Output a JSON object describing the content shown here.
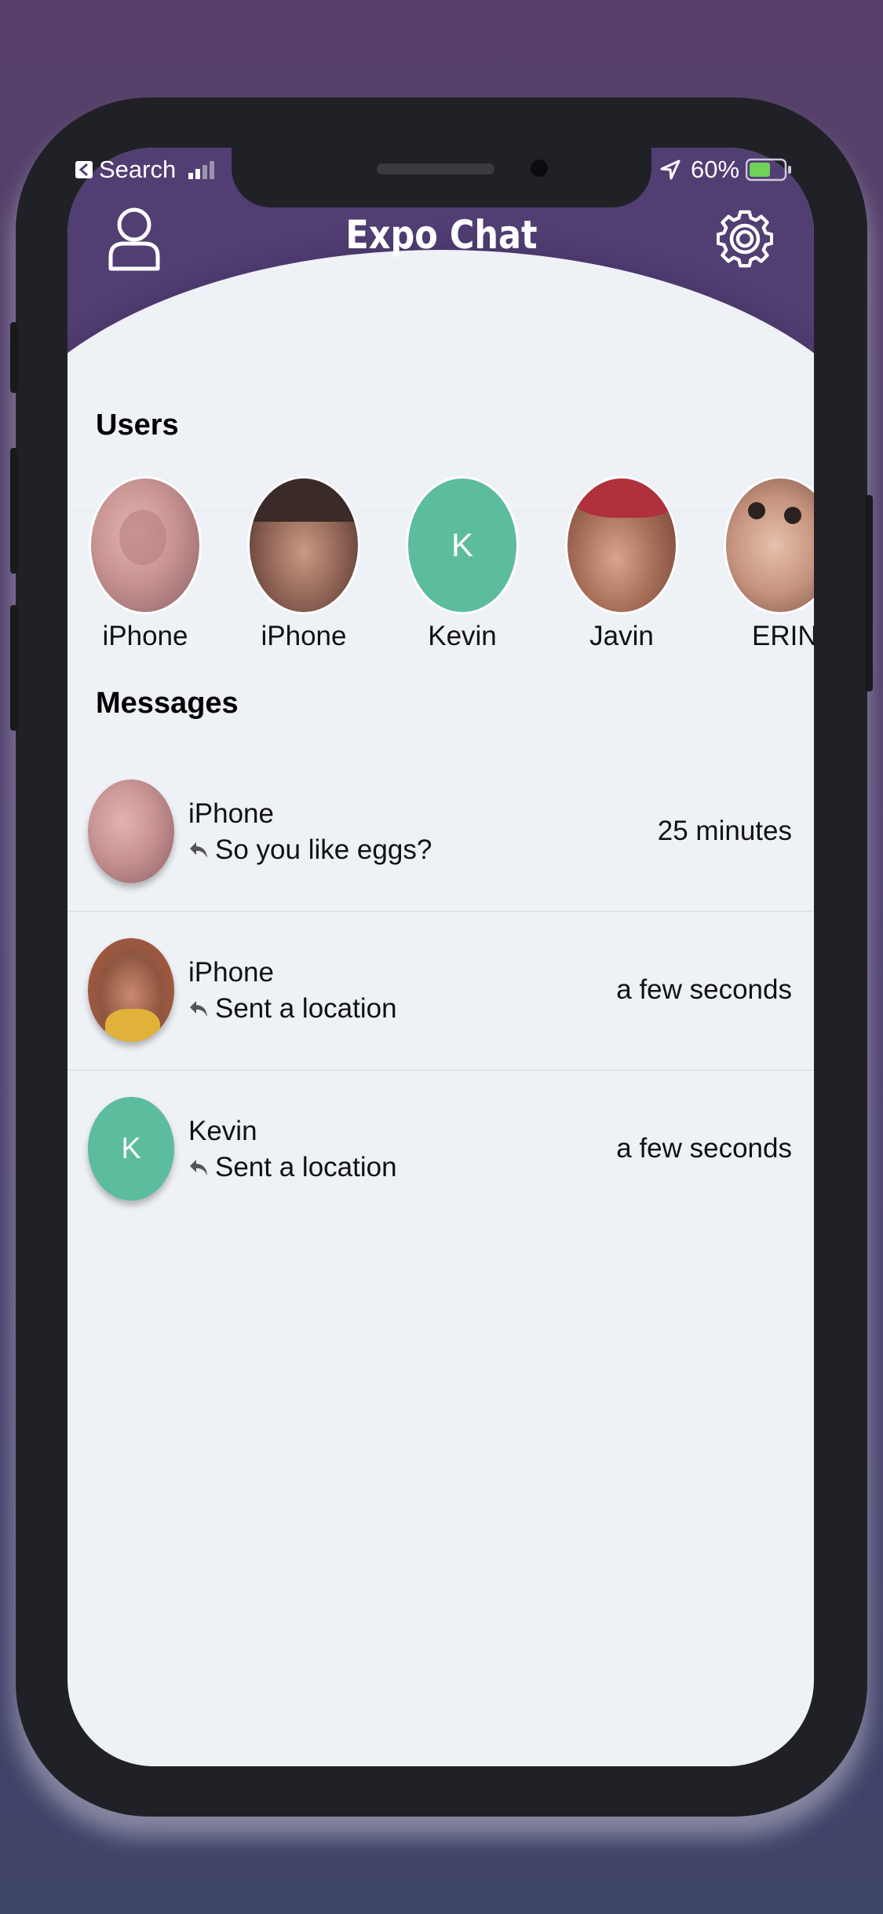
{
  "status_bar": {
    "back_label": "Search",
    "battery": "60%"
  },
  "header": {
    "title": "Expo Chat",
    "left_icon": "user-icon",
    "right_icon": "gear-icon"
  },
  "users_section": {
    "heading": "Users",
    "users": [
      {
        "name": "iPhone",
        "avatar": "photo"
      },
      {
        "name": "iPhone",
        "avatar": "photo"
      },
      {
        "name": "Kevin",
        "initial": "K",
        "color": "#5cbc9e"
      },
      {
        "name": "Javin",
        "avatar": "photo"
      },
      {
        "name": "ERIN",
        "avatar": "photo"
      }
    ]
  },
  "messages_section": {
    "heading": "Messages",
    "messages": [
      {
        "name": "iPhone",
        "preview": "So you like eggs?",
        "time": "25 minutes",
        "reply_icon": "reply-icon"
      },
      {
        "name": "iPhone",
        "preview": "Sent a location",
        "time": "a few seconds",
        "reply_icon": "reply-icon"
      },
      {
        "name": "Kevin",
        "initial": "K",
        "preview": "Sent a location",
        "time": "a few seconds",
        "reply_icon": "reply-icon",
        "color": "#5cbc9e"
      }
    ]
  },
  "colors": {
    "header": "#513e73",
    "background": "#eef1f6",
    "accent_green": "#5cbc9e"
  }
}
